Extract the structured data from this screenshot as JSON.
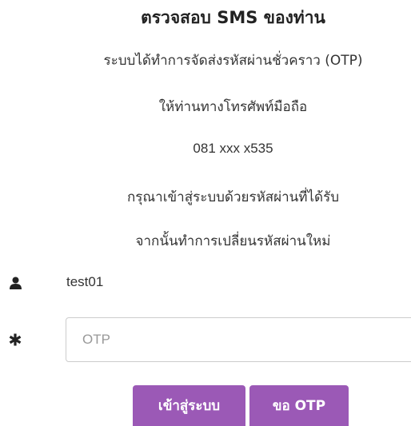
{
  "heading": "ตรวจสอบ SMS ของท่าน",
  "info": {
    "line1": "ระบบได้ทำการจัดส่งรหัสผ่านชั่วคราว (OTP)",
    "line2": "ให้ท่านทางโทรศัพท์มือถือ",
    "phone": "081 xxx x535",
    "line4": "กรุณาเข้าสู่ระบบด้วยรหัสผ่านที่ได้รับ",
    "line5": "จากนั้นทำการเปลี่ยนรหัสผ่านใหม่"
  },
  "username": {
    "icon": "user-icon",
    "value": "test01"
  },
  "otp_field": {
    "icon": "asterisk-icon",
    "placeholder": "OTP",
    "value": ""
  },
  "buttons": {
    "login": "เข้าสู่ระบบ",
    "request_otp": "ขอ OTP"
  },
  "colors": {
    "button_bg": "#9b59b6",
    "button_text": "#ffffff",
    "input_border": "#cccccc"
  }
}
